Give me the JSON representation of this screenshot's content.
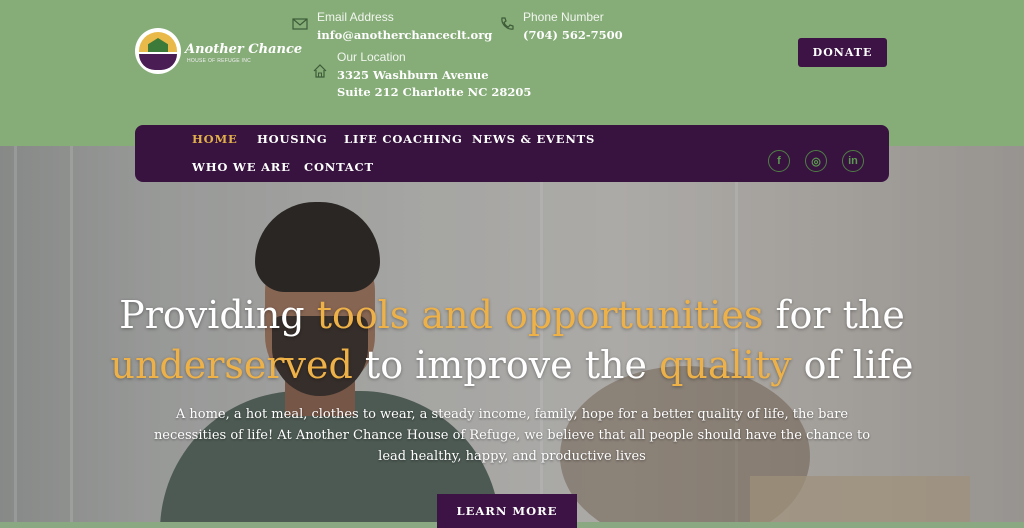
{
  "brand": {
    "name": "Another Chance",
    "subtitle": "HOUSE OF REFUGE INC"
  },
  "contact": {
    "email_label": "Email Address",
    "email_value": "info@anotherchanceclt.org",
    "phone_label": "Phone Number",
    "phone_value": "(704) 562-7500",
    "location_label": "Our Location",
    "location_line1": "3325 Washburn Avenue",
    "location_line2": "Suite 212 Charlotte NC 28205"
  },
  "donate_label": "DONATE",
  "nav": {
    "items": [
      "HOME",
      "HOUSING",
      "LIFE COACHING",
      "NEWS & EVENTS",
      "WHO WE ARE",
      "CONTACT"
    ],
    "active": "HOME"
  },
  "social": {
    "facebook": "f",
    "instagram": "◎",
    "linkedin": "in"
  },
  "hero": {
    "headline_parts": [
      "Providing ",
      "tools and opportunities",
      " for the ",
      "underserved",
      " to improve the ",
      "quality",
      " of life"
    ],
    "subtext": "A home, a hot meal, clothes to wear, a steady income, family, hope for a better quality of life, the bare necessities of life! At Another Chance House of Refuge, we believe that all people should have the chance to lead healthy, happy, and productive lives",
    "cta_label": "LEARN MORE"
  },
  "colors": {
    "topbar": "#86ad78",
    "purple": "#381340",
    "accent_gold": "#eeb148"
  }
}
